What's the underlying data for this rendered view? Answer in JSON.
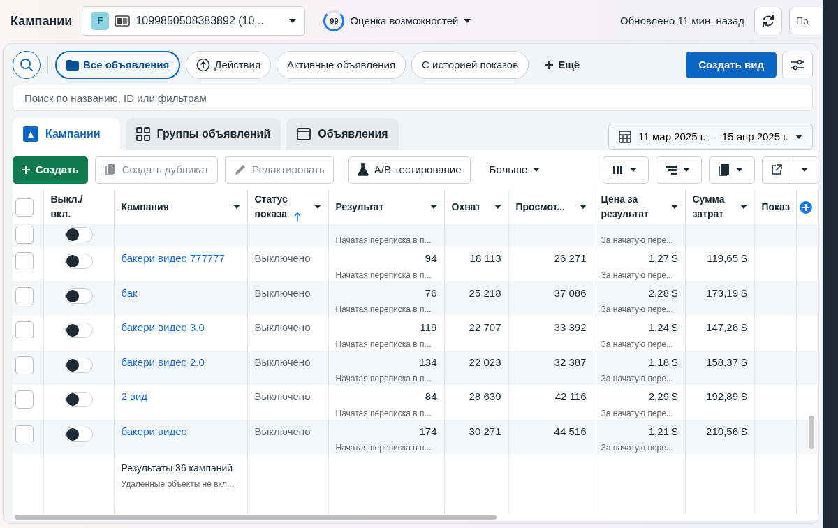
{
  "header": {
    "title": "Кампании",
    "account": {
      "badge": "F",
      "id": "1099850508383892 (10..."
    },
    "opportunity": {
      "score": "99",
      "label": "Оценка возможностей"
    },
    "updated": "Обновлено 11 мин. назад",
    "cut_button": "Пр"
  },
  "filters": [
    {
      "label": "Все объявления",
      "selected": true
    },
    {
      "label": "Действия",
      "selected": false
    },
    {
      "label": "Активные объявления",
      "selected": false
    },
    {
      "label": "С историей показов",
      "selected": false
    }
  ],
  "more_filters": "Ещё",
  "create_view": "Создать вид",
  "search": {
    "placeholder": "Поиск по названию, ID или фильтрам"
  },
  "tabs": [
    {
      "label": "Кампании",
      "selected": true
    },
    {
      "label": "Группы объявлений",
      "selected": false
    },
    {
      "label": "Объявления",
      "selected": false
    }
  ],
  "date_range": "11 мар 2025 г. — 15 апр 2025 г.",
  "toolbar": {
    "create": "Создать",
    "duplicate": {
      "label": "Создать дубликат",
      "disabled": true
    },
    "edit": {
      "label": "Редактировать",
      "disabled": true
    },
    "ab_test": "A/B-тестирование",
    "more": "Больше"
  },
  "table": {
    "select_all": {
      "checked": false
    },
    "columns": [
      {
        "label": "Выкл./вкл."
      },
      {
        "label": "Кампания"
      },
      {
        "label": "Статус показа",
        "sorted": true
      },
      {
        "label": "Результат"
      },
      {
        "label": "Охват"
      },
      {
        "label": "Просмот..."
      },
      {
        "label": "Цена за результат"
      },
      {
        "label": "Сумма затрат"
      },
      {
        "label": "Показ"
      }
    ],
    "rows": [
      {
        "checked": false,
        "on": false,
        "result_note": "Начатая переписка в п...",
        "price_note": "За начатую пере..."
      },
      {
        "checked": false,
        "on": false,
        "name": "бакери видео 777777",
        "status": "Выключено",
        "result": "94",
        "result_note": "Начатая переписка в п...",
        "reach": "18 113",
        "views": "26 271",
        "price": "1,27 $",
        "price_note": "За начатую пере...",
        "spend": "119,65 $"
      },
      {
        "checked": false,
        "on": false,
        "name": "бак",
        "status": "Выключено",
        "result": "76",
        "result_note": "Начатая переписка в п...",
        "reach": "25 218",
        "views": "37 086",
        "price": "2,28 $",
        "price_note": "За начатую пере...",
        "spend": "173,19 $"
      },
      {
        "checked": false,
        "on": false,
        "name": "бакери видео 3.0",
        "status": "Выключено",
        "result": "119",
        "result_note": "Начатая переписка в п...",
        "reach": "22 707",
        "views": "33 392",
        "price": "1,24 $",
        "price_note": "За начатую пере...",
        "spend": "147,26 $"
      },
      {
        "checked": false,
        "on": false,
        "name": "бакери видео 2.0",
        "status": "Выключено",
        "result": "134",
        "result_note": "Начатая переписка в п...",
        "reach": "22 023",
        "views": "32 387",
        "price": "1,18 $",
        "price_note": "За начатую пере...",
        "spend": "158,37 $"
      },
      {
        "checked": false,
        "on": false,
        "name": "2 вид",
        "status": "Выключено",
        "result": "84",
        "result_note": "Начатая переписка в п...",
        "reach": "28 639",
        "views": "42 116",
        "price": "2,29 $",
        "price_note": "За начатую пере...",
        "spend": "192,89 $"
      },
      {
        "checked": false,
        "on": false,
        "name": "бакери видео",
        "status": "Выключено",
        "result": "174",
        "result_note": "Начатая переписка в п...",
        "reach": "30 271",
        "views": "44 516",
        "price": "1,21 $",
        "price_note": "За начатую пере...",
        "spend": "210,56 $"
      }
    ],
    "footer": {
      "title": "Результаты 36 кампаний",
      "note": "Удаленные объекты не вкл..."
    }
  }
}
